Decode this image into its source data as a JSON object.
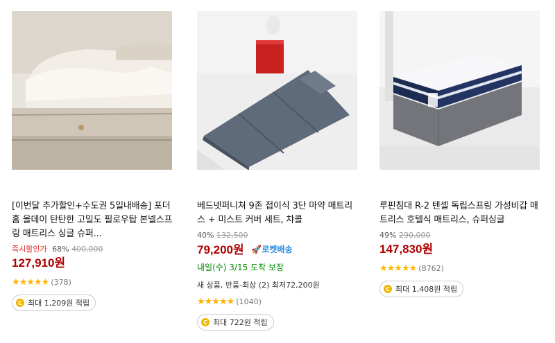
{
  "products": [
    {
      "title": "[이번달 추가할인+수도권 5일내배송] 포더홈 올데이 탄탄한 고밀도 필로우탑 본넬스프링 매트리스 싱글 슈퍼...",
      "instant_label": "즉시할인가",
      "discount_pct": "68%",
      "orig_price": "400,000",
      "price": "127,910원",
      "rocket": "",
      "delivery": "",
      "extra": "",
      "rating": 4.5,
      "stars": "★★★★★",
      "review_count": "(378)",
      "points": "최대 1,209원 적립"
    },
    {
      "title": "베드넷퍼니쳐 9존 접이식 3단 마약 매트리스 + 미스트 커버 세트, 챠콜",
      "instant_label": "",
      "discount_pct": "40%",
      "orig_price": "132,500",
      "price": "79,200원",
      "rocket": "로켓배송",
      "delivery": "내일(수) 3/15 도착 보장",
      "extra": "새 상품, 반품-최상 (2) 최저72,200원",
      "rating": 4.5,
      "stars": "★★★★★",
      "review_count": "(1040)",
      "points": "최대 722원 적립"
    },
    {
      "title": "루핀침대 R-2 텐셀 독립스프링 가성비갑 매트리스 호텔식 매트리스, 슈퍼싱글",
      "instant_label": "",
      "discount_pct": "49%",
      "orig_price": "290,000",
      "price": "147,830원",
      "rocket": "",
      "delivery": "",
      "extra": "",
      "rating": 4.5,
      "stars": "★★★★★",
      "review_count": "(8762)",
      "points": "최대 1,408원 적립"
    }
  ],
  "colors": {
    "price": "#ae0000",
    "rocket": "#2b8ae0",
    "delivery": "#008c00",
    "star": "#ffb400"
  }
}
